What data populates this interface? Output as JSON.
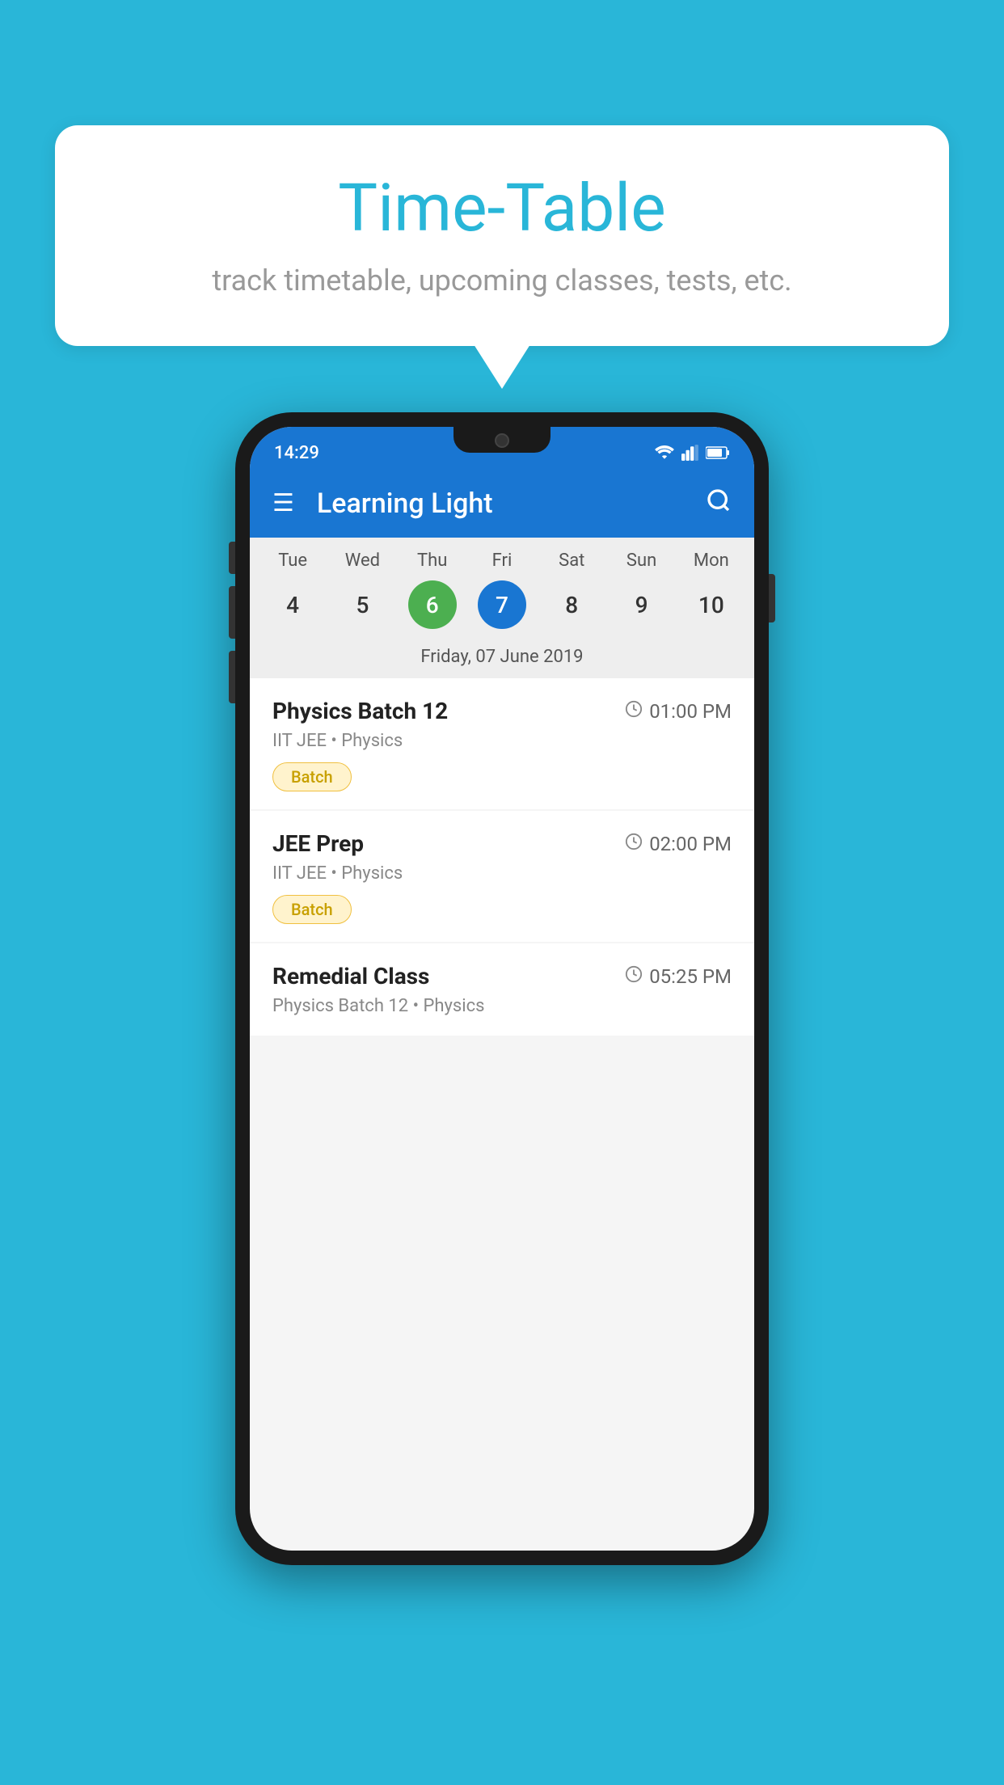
{
  "background": {
    "color": "#29B6D8"
  },
  "speech_bubble": {
    "title": "Time-Table",
    "subtitle": "track timetable, upcoming classes, tests, etc."
  },
  "phone": {
    "status_bar": {
      "time": "14:29"
    },
    "app_bar": {
      "title": "Learning Light"
    },
    "calendar": {
      "days": [
        "Tue",
        "Wed",
        "Thu",
        "Fri",
        "Sat",
        "Sun",
        "Mon"
      ],
      "dates": [
        {
          "num": "4",
          "state": "normal"
        },
        {
          "num": "5",
          "state": "normal"
        },
        {
          "num": "6",
          "state": "today"
        },
        {
          "num": "7",
          "state": "selected"
        },
        {
          "num": "8",
          "state": "normal"
        },
        {
          "num": "9",
          "state": "normal"
        },
        {
          "num": "10",
          "state": "normal"
        }
      ],
      "selected_label": "Friday, 07 June 2019"
    },
    "schedule": [
      {
        "title": "Physics Batch 12",
        "time": "01:00 PM",
        "subtitle": "IIT JEE • Physics",
        "badge": "Batch"
      },
      {
        "title": "JEE Prep",
        "time": "02:00 PM",
        "subtitle": "IIT JEE • Physics",
        "badge": "Batch"
      },
      {
        "title": "Remedial Class",
        "time": "05:25 PM",
        "subtitle": "Physics Batch 12 • Physics",
        "badge": null
      }
    ]
  }
}
